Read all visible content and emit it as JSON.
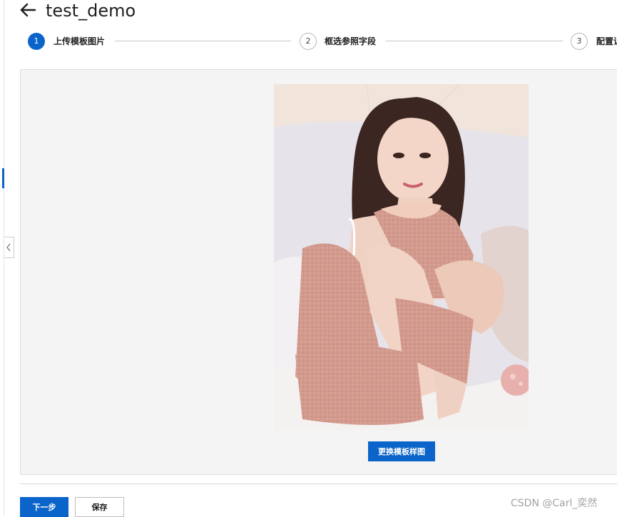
{
  "header": {
    "title": "test_demo"
  },
  "steps": [
    {
      "number": "1",
      "label": "上传模板图片",
      "state": "active"
    },
    {
      "number": "2",
      "label": "框选参照字段",
      "state": "inactive"
    },
    {
      "number": "3",
      "label": "配置识",
      "state": "inactive"
    }
  ],
  "preview": {
    "replace_label": "更换模板样图"
  },
  "footer": {
    "next_label": "下一步",
    "save_label": "保存"
  },
  "watermark": "CSDN @Carl_奕然",
  "colors": {
    "accent": "#0a64c9",
    "panel_bg": "#f4f4f4"
  }
}
